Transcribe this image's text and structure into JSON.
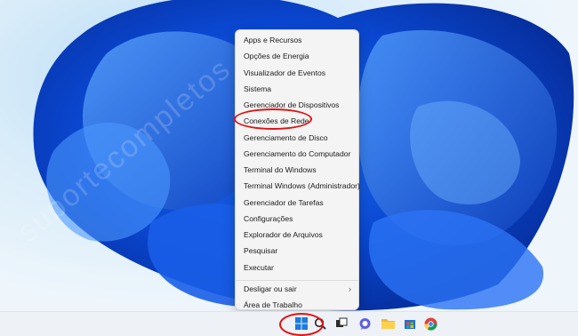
{
  "context_menu": {
    "items": [
      {
        "label": "Apps e Recursos"
      },
      {
        "label": "Opções de Energia"
      },
      {
        "label": "Visualizador de Eventos"
      },
      {
        "label": "Sistema"
      },
      {
        "label": "Gerenciador de Dispositivos"
      },
      {
        "label": "Conexões de Rede",
        "highlighted": true
      },
      {
        "label": "Gerenciamento de Disco"
      },
      {
        "label": "Gerenciamento do Computador"
      },
      {
        "label": "Terminal do Windows"
      },
      {
        "label": "Terminal Windows (Administrador)"
      },
      {
        "label": "Gerenciador de Tarefas"
      },
      {
        "label": "Configurações"
      },
      {
        "label": "Explorador de Arquivos"
      },
      {
        "label": "Pesquisar"
      },
      {
        "label": "Executar"
      },
      {
        "label": "Desligar ou sair",
        "has_submenu": true,
        "chevron": "›"
      },
      {
        "label": "Área de Trabalho"
      }
    ]
  },
  "annotation": {
    "highlight_color": "#e01313"
  },
  "taskbar": {
    "icons": [
      {
        "name": "start-icon"
      },
      {
        "name": "search-icon"
      },
      {
        "name": "task-view-icon"
      },
      {
        "name": "chat-icon"
      },
      {
        "name": "file-explorer-icon"
      },
      {
        "name": "microsoft-store-icon"
      },
      {
        "name": "chrome-icon"
      }
    ]
  },
  "watermark_text": "suportecompletos"
}
